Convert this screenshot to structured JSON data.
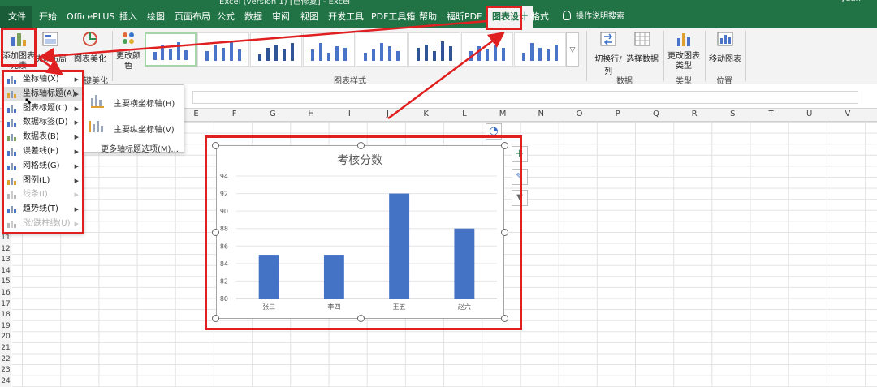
{
  "titlebar": {
    "title": "Excel (version 1) [已修复]  -  Excel",
    "user": "yuan"
  },
  "tabs": [
    {
      "label": "文件",
      "x": 0
    },
    {
      "label": "开始",
      "x": 48
    },
    {
      "label": "OfficePLUS",
      "x": 82
    },
    {
      "label": "插入",
      "x": 147
    },
    {
      "label": "绘图",
      "x": 181
    },
    {
      "label": "页面布局",
      "x": 215
    },
    {
      "label": "公式",
      "x": 267
    },
    {
      "label": "数据",
      "x": 301
    },
    {
      "label": "审阅",
      "x": 335
    },
    {
      "label": "视图",
      "x": 370
    },
    {
      "label": "开发工具",
      "x": 404
    },
    {
      "label": "PDF工具箱",
      "x": 457
    },
    {
      "label": "帮助",
      "x": 516
    },
    {
      "label": "福昕PDF",
      "x": 550
    },
    {
      "label": "图表设计",
      "x": 600
    },
    {
      "label": "格式",
      "x": 654
    }
  ],
  "tell_me": "操作说明搜索",
  "ribbon": {
    "add_element": "添加图表元素",
    "quick_layout": "快速布局",
    "beautify": "图表美化",
    "change_colors": "更改颜色",
    "switch_row_col": "切换行/列",
    "select_data": "选择数据",
    "change_type": "更改图表类型",
    "move_chart": "移动图表",
    "group_beautify": "美化",
    "group_layout": "键美化",
    "group_styles": "图表样式",
    "group_data": "数据",
    "group_type": "类型",
    "group_location": "位置"
  },
  "columns": [
    "E",
    "F",
    "G",
    "H",
    "I",
    "J",
    "K",
    "L",
    "M",
    "N",
    "O",
    "P",
    "Q",
    "R",
    "S",
    "T",
    "U",
    "V"
  ],
  "rows": [
    "11",
    "12",
    "13",
    "14",
    "15",
    "16",
    "17",
    "18",
    "19",
    "20",
    "21",
    "22",
    "23",
    "24"
  ],
  "menu": [
    {
      "label": "坐标轴(X)",
      "enabled": true
    },
    {
      "label": "坐标轴标题(A)",
      "enabled": true
    },
    {
      "label": "图表标题(C)",
      "enabled": true
    },
    {
      "label": "数据标签(D)",
      "enabled": true
    },
    {
      "label": "数据表(B)",
      "enabled": true
    },
    {
      "label": "误差线(E)",
      "enabled": true
    },
    {
      "label": "网格线(G)",
      "enabled": true
    },
    {
      "label": "图例(L)",
      "enabled": true
    },
    {
      "label": "线条(I)",
      "enabled": false
    },
    {
      "label": "趋势线(T)",
      "enabled": true
    },
    {
      "label": "涨/跌柱线(U)",
      "enabled": false
    }
  ],
  "submenu": {
    "primary_horizontal": "主要横坐标轴(H)",
    "primary_vertical": "主要纵坐标轴(V)",
    "more_options": "更多轴标题选项(M)..."
  },
  "chart_data": {
    "type": "bar",
    "title": "考核分数",
    "categories": [
      "张三",
      "李四",
      "王五",
      "赵六"
    ],
    "values": [
      85,
      85,
      92,
      88
    ],
    "ylim": [
      80,
      94
    ],
    "yticks": [
      80,
      82,
      84,
      86,
      88,
      90,
      92,
      94
    ],
    "xlabel": "",
    "ylabel": "",
    "grid": true,
    "bar_color": "#4472c4"
  },
  "colors": {
    "accent": "#217346",
    "annotation": "#e02020",
    "bar": "#4472c4"
  }
}
